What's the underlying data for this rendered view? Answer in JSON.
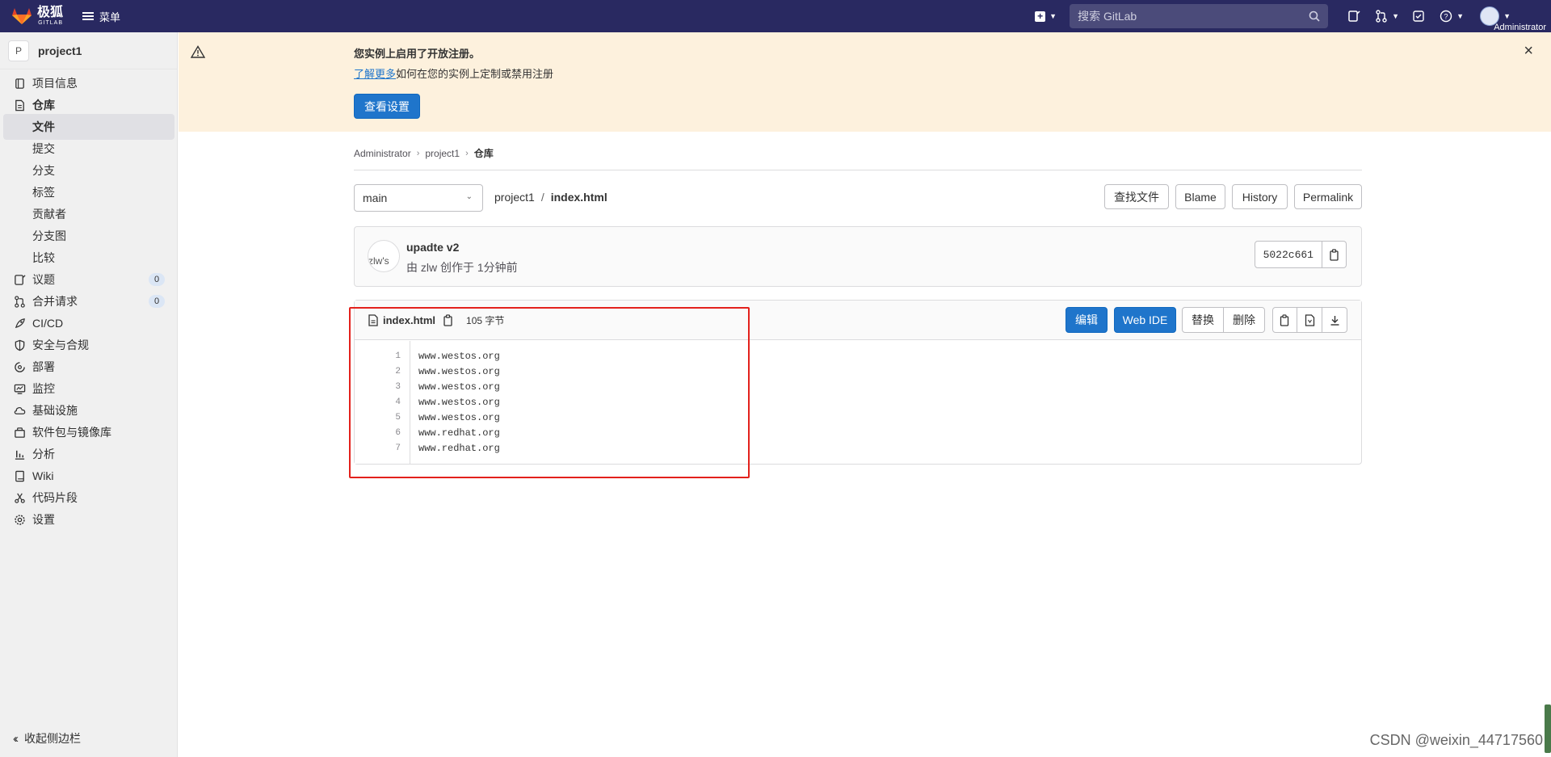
{
  "topbar": {
    "logo_main": "极狐",
    "logo_sub": "GITLAB",
    "menu_label": "菜单",
    "search_placeholder": "搜索 GitLab",
    "user_label": "Administrator"
  },
  "sidebar": {
    "project_initial": "P",
    "project_name": "project1",
    "items": [
      {
        "label": "项目信息",
        "icon": "info-icon"
      },
      {
        "label": "仓库",
        "icon": "repository-icon"
      },
      {
        "label": "文件"
      },
      {
        "label": "提交"
      },
      {
        "label": "分支"
      },
      {
        "label": "标签"
      },
      {
        "label": "贡献者"
      },
      {
        "label": "分支图"
      },
      {
        "label": "比较"
      },
      {
        "label": "议题",
        "icon": "issues-icon",
        "badge": "0"
      },
      {
        "label": "合并请求",
        "icon": "merge-request-icon",
        "badge": "0"
      },
      {
        "label": "CI/CD",
        "icon": "rocket-icon"
      },
      {
        "label": "安全与合规",
        "icon": "shield-icon"
      },
      {
        "label": "部署",
        "icon": "deployments-icon"
      },
      {
        "label": "监控",
        "icon": "monitor-icon"
      },
      {
        "label": "基础设施",
        "icon": "cloud-gear-icon"
      },
      {
        "label": "软件包与镜像库",
        "icon": "package-icon"
      },
      {
        "label": "分析",
        "icon": "chart-icon"
      },
      {
        "label": "Wiki",
        "icon": "book-icon"
      },
      {
        "label": "代码片段",
        "icon": "snippet-icon"
      },
      {
        "label": "设置",
        "icon": "gear-icon"
      }
    ],
    "collapse_label": "收起侧边栏"
  },
  "alert": {
    "title": "您实例上启用了开放注册。",
    "link": "了解更多",
    "desc": "如何在您的实例上定制或禁用注册",
    "button": "查看设置",
    "close": "×"
  },
  "breadcrumb": {
    "items": [
      "Administrator",
      "project1",
      "仓库"
    ]
  },
  "repo": {
    "branch": "main",
    "path_project": "project1",
    "path_sep": "/",
    "path_file": "index.html",
    "find_file": "查找文件",
    "blame": "Blame",
    "history": "History",
    "permalink": "Permalink"
  },
  "commit": {
    "avatar_alt": "zlw's",
    "title": "upadte v2",
    "meta": "由 zlw 创作于 1分钟前",
    "sha": "5022c661"
  },
  "file": {
    "name": "index.html",
    "size": "105 字节",
    "edit": "编辑",
    "web_ide": "Web IDE",
    "replace": "替换",
    "delete": "删除",
    "lines": [
      {
        "n": "1",
        "text": "www.westos.org"
      },
      {
        "n": "2",
        "text": "www.westos.org"
      },
      {
        "n": "3",
        "text": "www.westos.org"
      },
      {
        "n": "4",
        "text": "www.westos.org"
      },
      {
        "n": "5",
        "text": "www.westos.org"
      },
      {
        "n": "6",
        "text": "www.redhat.org"
      },
      {
        "n": "7",
        "text": "www.redhat.org"
      }
    ]
  },
  "watermark": "CSDN @weixin_44717560",
  "colors": {
    "topbar": "#292961",
    "primary": "#1f75cb",
    "alert_bg": "#fdf1dd",
    "highlight": "#e3211c"
  }
}
